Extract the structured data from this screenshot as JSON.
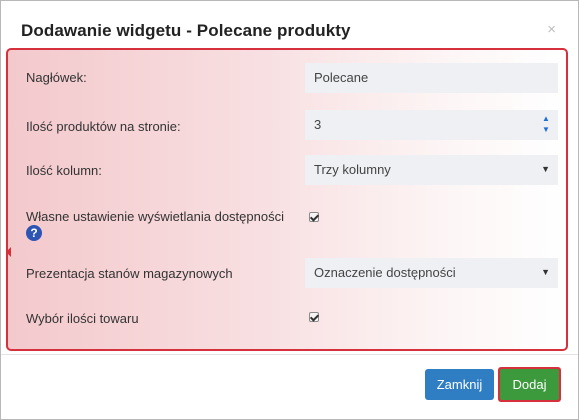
{
  "dialog": {
    "title": "Dodawanie widgetu - Polecane produkty",
    "close_glyph": "×"
  },
  "form": {
    "header_label": "Nagłówek:",
    "header_value": "Polecane",
    "products_label": "Ilość produktów na stronie:",
    "products_value": "3",
    "columns_label": "Ilość kolumn:",
    "columns_value": "Trzy kolumny",
    "availability_label": "Własne ustawienie wyświetlania dostępności",
    "availability_checked": true,
    "help_glyph": "?",
    "stock_label": "Prezentacja stanów magazynowych",
    "stock_value": "Oznaczenie dostępności",
    "quantity_label": "Wybór ilości towaru",
    "quantity_checked": true
  },
  "footer": {
    "close_label": "Zamknij",
    "add_label": "Dodaj"
  },
  "colors": {
    "highlight": "#d6303c",
    "primary": "#2f7dc3",
    "success": "#3d9a3c",
    "field_bg": "#eef0f4"
  }
}
